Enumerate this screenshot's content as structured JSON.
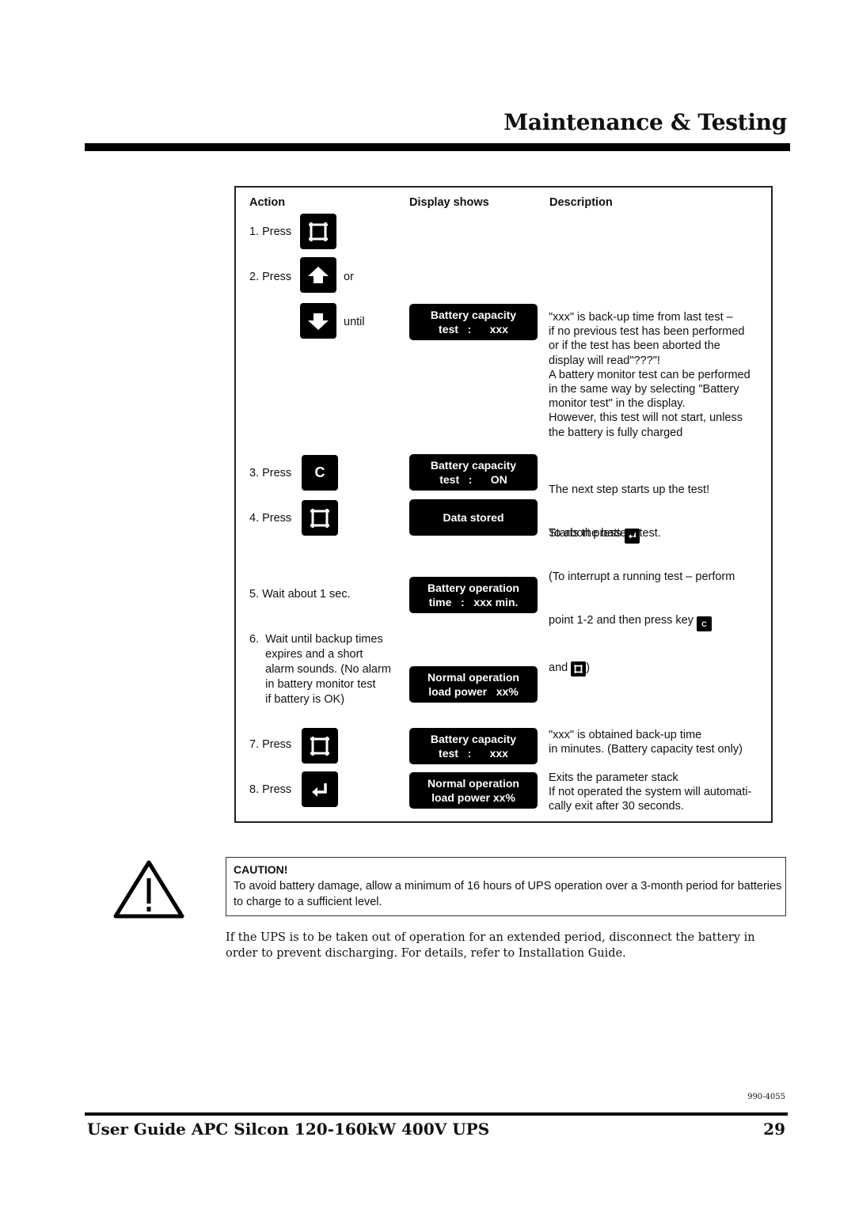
{
  "header": {
    "title": "Maintenance & Testing"
  },
  "table": {
    "headers": {
      "action": "Action",
      "display": "Display shows",
      "description": "Description"
    },
    "steps": [
      {
        "action": "1. Press",
        "key": "enter-parameter-key-icon"
      },
      {
        "action": "2. Press",
        "key": "arrow-up-key-icon",
        "suffix": "or"
      },
      {
        "action": "",
        "key": "arrow-down-key-icon",
        "suffix": "until",
        "display": "Battery capacity\ntest   :      xxx",
        "description": "\"xxx\" is back-up time from last test –\nif no previous test has been performed\nor if the test has been aborted the\ndisplay will read\"???\"!\nA battery monitor test can be performed\nin the same way by selecting \"Battery\nmonitor test\" in the display.\nHowever, this test will not start, unless\nthe battery is fully charged"
      },
      {
        "action": "3. Press",
        "key": "c-key-icon",
        "key_label": "C",
        "display": "Battery capacity\ntest   :      ON",
        "description_line1": "The next step starts up the test!",
        "description_line2": "To abort press"
      },
      {
        "action": "4. Press",
        "key": "enter-parameter-key-icon",
        "display": "Data stored",
        "description_line1": "Starts the battery test.",
        "description_line2": "(To interrupt a running test – perform",
        "description_line3": "point 1-2 and then press key",
        "description_line4": "and",
        "description_line4_end": ")",
        "mini_key_label": "C"
      },
      {
        "action": "5. Wait about 1 sec.",
        "display": "Battery operation\ntime   :   xxx min."
      },
      {
        "action": "6.  Wait until backup times\n     expires and a short\n     alarm sounds. (No alarm\n     in battery monitor test\n     if battery is OK)",
        "display": "Normal operation\nload power   xx%"
      },
      {
        "action": "7.  Press",
        "key": "enter-parameter-key-icon",
        "display": "Battery capacity\ntest   :      xxx",
        "description": "\"xxx\" is obtained back-up time\nin minutes. (Battery capacity test only)"
      },
      {
        "action": "8.  Press",
        "key": "return-key-icon",
        "display": "Normal operation\nload power xx%",
        "description": "Exits the parameter stack\nIf not operated the system will automati-\ncally exit after 30 seconds."
      }
    ]
  },
  "caution": {
    "title": "CAUTION!",
    "text": "To avoid battery damage, allow  a minimum of 16 hours of UPS operation over a 3-month period for batteries to charge to a sufficient level."
  },
  "body_paragraph": "If the UPS is to be taken out of operation for an extended period, disconnect the battery in order to prevent discharging. For details, refer to Installation Guide.",
  "footer": {
    "doc_number": "990-4055",
    "title": "User Guide APC Silcon 120-160kW 400V UPS",
    "page_number": "29"
  }
}
